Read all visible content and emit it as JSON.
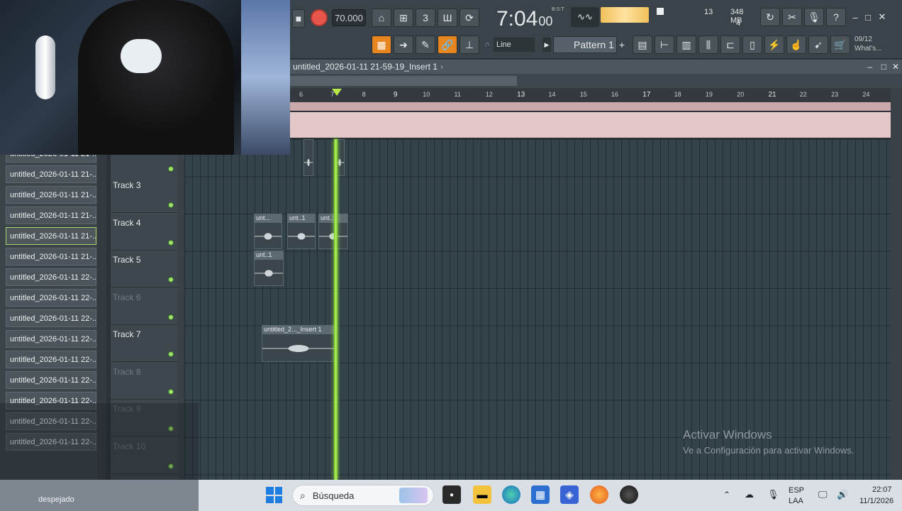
{
  "toolbar": {
    "tempo": "70.000",
    "time_main": "7:04",
    "time_sub": "00",
    "time_fmt": "B:S:T",
    "cpu_voices": "13",
    "memory": "348 MB",
    "polyphony": "4",
    "snap_mode": "Line",
    "pattern": "Pattern 1",
    "news_date": "09/12",
    "news_label": "What's..."
  },
  "playlist": {
    "title": "untitled_2026-01-11 21-59-19_Insert 1",
    "bars": [
      "6",
      "7",
      "8",
      "9",
      "10",
      "11",
      "12",
      "13",
      "14",
      "15",
      "16",
      "17",
      "18",
      "19",
      "20",
      "21",
      "22",
      "23",
      "24"
    ]
  },
  "browser": {
    "items": [
      "untitled_2026-01-11 21-...",
      "untitled_2026-01-11 21-...",
      "untitled_2026-01-11 21-...",
      "untitled_2026-01-11 21-...",
      "untitled_2026-01-11 21-...",
      "untitled_2026-01-11 21-...",
      "untitled_2026-01-11 22-...",
      "untitled_2026-01-11 22-...",
      "untitled_2026-01-11 22-...",
      "untitled_2026-01-11 22-...",
      "untitled_2026-01-11 22-...",
      "untitled_2026-01-11 22-...",
      "untitled_2026-01-11 22-...",
      "untitled_2026-01-11 22-...",
      "untitled_2026-01-11 22-..."
    ],
    "selected_index": 4
  },
  "tracks": [
    {
      "name": "Track 3",
      "dim": false
    },
    {
      "name": "Track 4",
      "dim": false
    },
    {
      "name": "Track 5",
      "dim": false
    },
    {
      "name": "Track 6",
      "dim": true
    },
    {
      "name": "Track 7",
      "dim": false
    },
    {
      "name": "Track 8",
      "dim": true
    },
    {
      "name": "Track 9",
      "dim": true
    },
    {
      "name": "Track 10",
      "dim": true
    }
  ],
  "clips": {
    "track4": [
      "unt...",
      "unt..1",
      "unt..1"
    ],
    "track5": [
      "unt..1"
    ],
    "track7": [
      "untitled_2..._Insert 1"
    ]
  },
  "watermark": {
    "line1": "Activar Windows",
    "line2": "Ve a Configuración para activar Windows."
  },
  "taskbar": {
    "weather": "despejado",
    "search_placeholder": "Búsqueda",
    "lang": "ESP",
    "region": "LAA",
    "time": "22:07",
    "date": "11/1/2026"
  },
  "colors": {
    "accent_orange": "#e7861e",
    "playhead_green": "#9bf04a",
    "record_red": "#e8554b"
  }
}
